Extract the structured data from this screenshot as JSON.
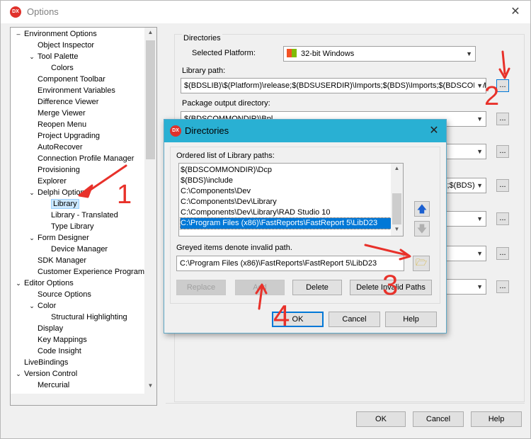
{
  "window": {
    "title": "Options",
    "icon": "DX"
  },
  "tree": {
    "items": [
      {
        "label": "Environment Options",
        "toggle": "-"
      },
      {
        "label": "Object Inspector",
        "toggle": ""
      },
      {
        "label": "Tool Palette",
        "toggle": "v"
      },
      {
        "label": "Colors",
        "toggle": ""
      },
      {
        "label": "Component Toolbar",
        "toggle": ""
      },
      {
        "label": "Environment Variables",
        "toggle": ""
      },
      {
        "label": "Difference Viewer",
        "toggle": ""
      },
      {
        "label": "Merge Viewer",
        "toggle": ""
      },
      {
        "label": "Reopen Menu",
        "toggle": ""
      },
      {
        "label": "Project Upgrading",
        "toggle": ""
      },
      {
        "label": "AutoRecover",
        "toggle": ""
      },
      {
        "label": "Connection Profile Manager",
        "toggle": ""
      },
      {
        "label": "Provisioning",
        "toggle": ""
      },
      {
        "label": "Explorer",
        "toggle": ""
      },
      {
        "label": "Delphi Options",
        "toggle": "v"
      },
      {
        "label": "Library",
        "toggle": "",
        "selected": true
      },
      {
        "label": "Library - Translated",
        "toggle": ""
      },
      {
        "label": "Type Library",
        "toggle": ""
      },
      {
        "label": "Form Designer",
        "toggle": "v"
      },
      {
        "label": "Device Manager",
        "toggle": ""
      },
      {
        "label": "SDK Manager",
        "toggle": ""
      },
      {
        "label": "Customer Experience Program",
        "toggle": ""
      },
      {
        "label": "Editor Options",
        "toggle": "v"
      },
      {
        "label": "Source Options",
        "toggle": ""
      },
      {
        "label": "Color",
        "toggle": "v"
      },
      {
        "label": "Structural Highlighting",
        "toggle": ""
      },
      {
        "label": "Display",
        "toggle": ""
      },
      {
        "label": "Key Mappings",
        "toggle": ""
      },
      {
        "label": "Code Insight",
        "toggle": ""
      },
      {
        "label": "LiveBindings",
        "toggle": ""
      },
      {
        "label": "Version Control",
        "toggle": "v"
      },
      {
        "label": "Mercurial",
        "toggle": ""
      }
    ]
  },
  "directories": {
    "group_label": "Directories",
    "platform_label": "Selected Platform:",
    "platform_value": "32-bit Windows",
    "library_path_label": "Library path:",
    "library_path_value": "$(BDSLIB)\\$(Platform)\\release;$(BDSUSERDIR)\\Imports;$(BDS)\\Imports;$(BDSCOMM",
    "package_output_label": "Package output directory:",
    "package_output_value": "$(BDSCOMMONDIR)\\Bpl",
    "partial_value": "s;$(BDS)",
    "browse_label": "..."
  },
  "dialog": {
    "title": "Directories",
    "list_label": "Ordered list of Library paths:",
    "paths": [
      "$(BDSCOMMONDIR)\\Dcp",
      "$(BDS)\\include",
      "C:\\Components\\Dev",
      "C:\\Components\\Dev\\Library",
      "C:\\Components\\Dev\\Library\\RAD Studio 10",
      "C:\\Program Files (x86)\\FastReports\\FastReport 5\\LibD23"
    ],
    "greyed_note": "Greyed items denote invalid path.",
    "path_input": "C:\\Program Files (x86)\\FastReports\\FastReport 5\\LibD23",
    "buttons": {
      "replace": "Replace",
      "add": "Add",
      "delete": "Delete",
      "delete_invalid": "Delete Invalid Paths",
      "ok": "OK",
      "cancel": "Cancel",
      "help": "Help"
    }
  },
  "footer": {
    "ok": "OK",
    "cancel": "Cancel",
    "help": "Help"
  },
  "annotations": [
    "1",
    "2",
    "3",
    "4"
  ]
}
